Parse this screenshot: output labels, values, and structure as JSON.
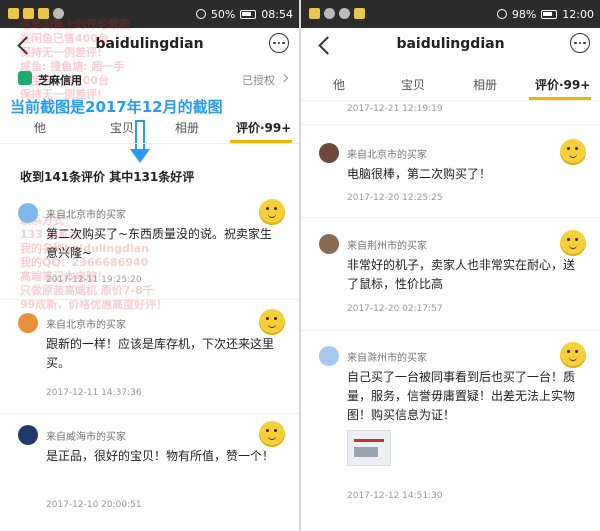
{
  "left": {
    "statusbar": {
      "battery": "50%",
      "time": "08:54"
    },
    "nav": {
      "title": "baidulingdian"
    },
    "zhima": {
      "label": "芝麻信用",
      "status": "已授权"
    },
    "watermark_top": [
      "这是闲鱼上的评论截图",
      "在闲鱼已售400台",
      "保持无一例差评!",
      "咸鱼: 搜鱼塘: 超一手",
      "淘宝店，售100台",
      "保持无一例差评!"
    ],
    "watermark_mid": [
      "联系方式：",
      "133 联系我",
      "我的名称baidulingdian",
      "我的QQ：2366686940",
      "高端笔记本电脑！",
      "只做原装高端机 原价7-8千",
      "99成新，价格优惠高度好评！"
    ],
    "annotation": "当前截图是2017年12月的截图",
    "tabs": [
      {
        "label": "他",
        "active": false
      },
      {
        "label": "宝贝",
        "active": false
      },
      {
        "label": "相册",
        "active": false
      },
      {
        "label": "评价·99+",
        "active": true
      }
    ],
    "summary": "收到141条评价 其中131条好评",
    "reviews": [
      {
        "source": "来自北京市的买家",
        "text": "第二次购买了~东西质量没的说。祝卖家生意兴隆~",
        "time": "2017-12-11 19:25:20",
        "avatar_color": "#7fb7e8"
      },
      {
        "source": "来自北京市的买家",
        "text": "跟新的一样！应该是库存机，下次还来这里买。",
        "time": "2017-12-11 14:37:36",
        "avatar_color": "#e8913a"
      },
      {
        "source": "来自威海市的买家",
        "text": "是正品，很好的宝贝！物有所值，赞一个！",
        "time": "2017-12-10 20:00:51",
        "avatar_color": "#1f3a66"
      }
    ]
  },
  "right": {
    "statusbar": {
      "battery": "98%",
      "time": "12:00"
    },
    "nav": {
      "title": "baidulingdian"
    },
    "tabs": [
      {
        "label": "他",
        "active": false
      },
      {
        "label": "宝贝",
        "active": false
      },
      {
        "label": "相册",
        "active": false
      },
      {
        "label": "评价·99+",
        "active": true
      }
    ],
    "top_time": "2017-12-21 12:19:19",
    "reviews": [
      {
        "source": "来自北京市的买家",
        "text": "电脑很棒，第二次购买了！",
        "time": "2017-12-20 12:25:25",
        "avatar_color": "#6b4a3a"
      },
      {
        "source": "来自荆州市的买家",
        "text": "非常好的机子，卖家人也非常实在耐心，送了鼠标，性价比高",
        "time": "2017-12-20 02:17:57",
        "avatar_color": "#8a6c55"
      },
      {
        "source": "来自滁州市的买家",
        "text": "自己买了一台被同事看到后也买了一台！质量，服务，信誉毋庸置疑！出差无法上实物图！购买信息为证！",
        "time": "2017-12-12 14:51:30",
        "avatar_color": "#a9c8ef"
      }
    ]
  }
}
